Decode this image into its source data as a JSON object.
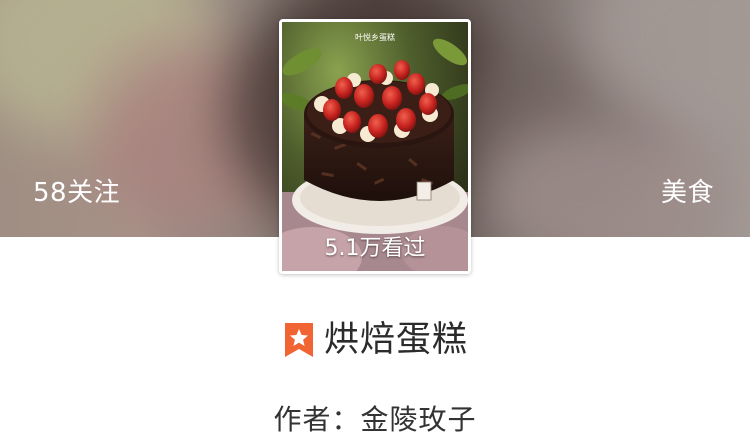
{
  "hero": {
    "follow_text": "58关注",
    "category": "美食"
  },
  "cover": {
    "views_text": "5.1万看过",
    "watermark_text": "叶悦乡蛋糕"
  },
  "book": {
    "title": "烘焙蛋糕",
    "author": "作者：金陵玫子",
    "badge_color": "#f06533"
  }
}
